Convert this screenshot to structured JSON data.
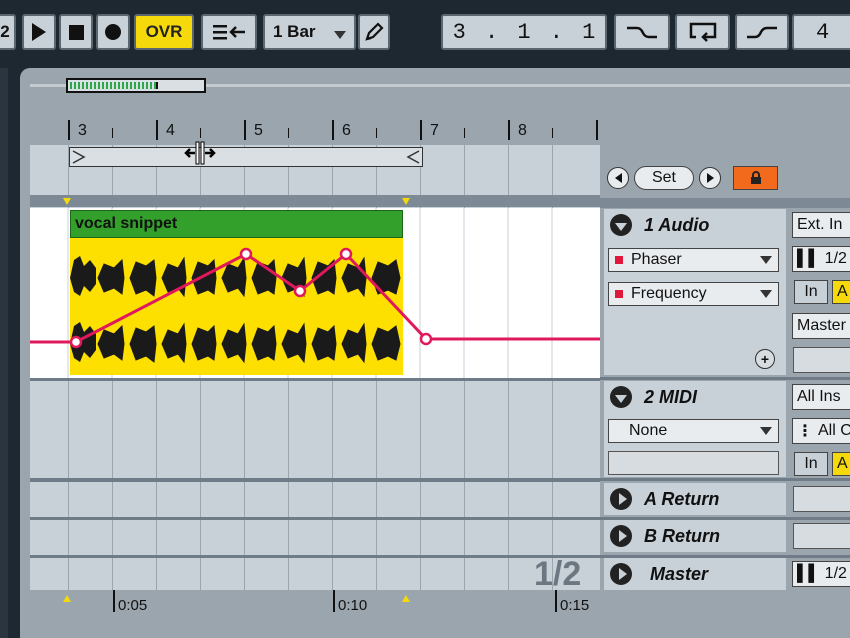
{
  "transport": {
    "left_number": "2",
    "ovr_label": "OVR",
    "quantize_label": "1 Bar",
    "position": [
      "3",
      "1",
      "1"
    ],
    "right_number": "4"
  },
  "ruler": {
    "bars": [
      "3",
      "4",
      "5",
      "6",
      "7",
      "8"
    ]
  },
  "clip": {
    "name": "vocal snippet"
  },
  "locators": {
    "set_label": "Set"
  },
  "tracks": {
    "audio": {
      "name": "1 Audio",
      "device": "Phaser",
      "parameter": "Frequency",
      "input": "Ext. In",
      "channel": "1/2",
      "monitor": "In",
      "auto_label": "A",
      "output": "Master"
    },
    "midi": {
      "name": "2 MIDI",
      "device": "None",
      "input": "All Ins",
      "channel": "All C",
      "monitor": "In",
      "auto_label": "A"
    },
    "return_a": {
      "name": "A Return"
    },
    "return_b": {
      "name": "B Return"
    },
    "master": {
      "name": "Master",
      "channel": "1/2"
    }
  },
  "scroll_indicator": "1/2",
  "timeline": [
    "0:05",
    "0:10",
    "0:15"
  ],
  "colors": {
    "clip": "#fde000",
    "clip_header": "#32a02b",
    "automation": "#e0185c",
    "ovr": "#f5d90a",
    "lock": "#f26a1b"
  }
}
